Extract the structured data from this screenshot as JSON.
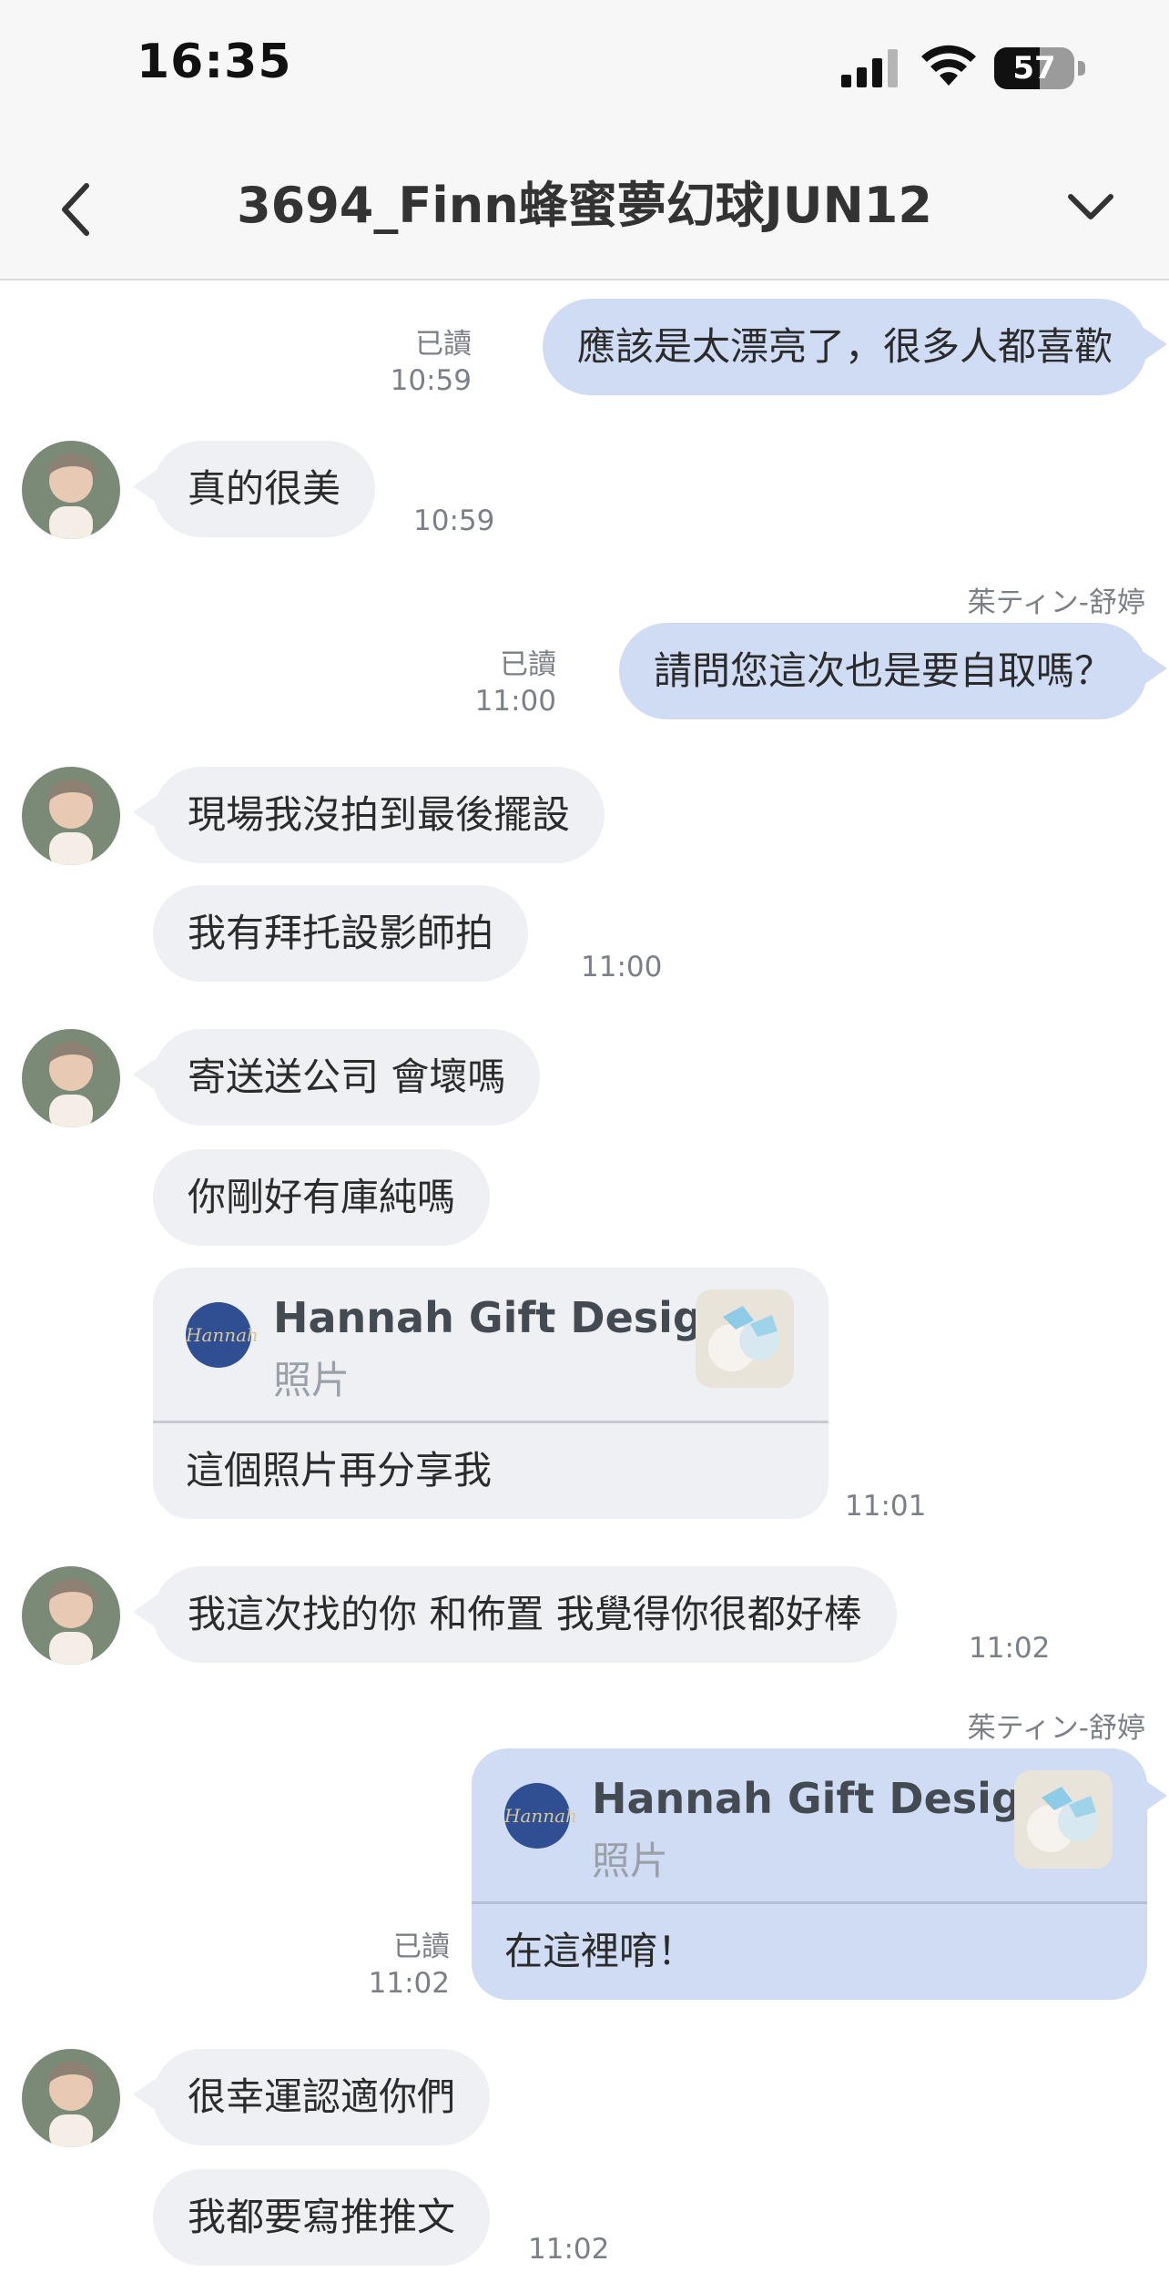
{
  "status_bar": {
    "time": "16:35",
    "battery": "57",
    "battery_level": 0.57
  },
  "header": {
    "title": "3694_Finn蜂蜜夢幻球JUN12"
  },
  "messages": {
    "m1": {
      "read": "已讀",
      "time": "10:59",
      "text": "應該是太漂亮了，很多人都喜歡"
    },
    "m2": {
      "text": "真的很美",
      "time": "10:59"
    },
    "m3": {
      "sender": "茱ティン-舒婷",
      "read": "已讀",
      "time": "11:00",
      "text": "請問您這次也是要自取嗎？"
    },
    "m4": {
      "text": "現場我沒拍到最後擺設"
    },
    "m5": {
      "text": "我有拜托設影師拍",
      "time": "11:00"
    },
    "m6": {
      "text": "寄送送公司 會壞嗎"
    },
    "m7": {
      "text": "你剛好有庫純嗎"
    },
    "m8": {
      "card_name": "Hannah Gift Design",
      "card_sub": "照片",
      "text": "這個照片再分享我",
      "time": "11:01"
    },
    "m9": {
      "text": "我這次找的你 和佈置 我覺得你很都好棒",
      "time": "11:02"
    },
    "m10": {
      "sender": "茱ティン-舒婷",
      "card_name": "Hannah Gift Design",
      "card_sub": "照片",
      "text": "在這裡唷！",
      "read": "已讀",
      "time": "11:02"
    },
    "m11": {
      "text": "很幸運認適你們"
    },
    "m12": {
      "text": "我都要寫推推文",
      "time": "11:02"
    }
  },
  "icons": {
    "back": "chevron-left-icon",
    "expand": "chevron-down-icon",
    "signal": "cellular-signal-icon",
    "wifi": "wifi-icon",
    "battery": "battery-icon"
  },
  "colors": {
    "incoming_bubble": "#eef0f4",
    "outgoing_bubble": "#d0dcf4",
    "logo_bg": "#2f4f92"
  }
}
